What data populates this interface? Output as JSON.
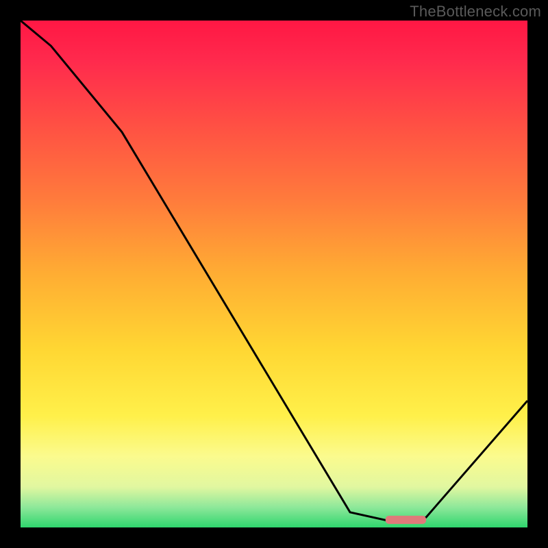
{
  "watermark": "TheBottleneck.com",
  "chart_data": {
    "type": "line",
    "title": "",
    "xlabel": "",
    "ylabel": "",
    "xlim": [
      0,
      100
    ],
    "ylim": [
      0,
      100
    ],
    "grid": false,
    "series": [
      {
        "name": "curve",
        "x": [
          0,
          6,
          20,
          65,
          74,
          80,
          100
        ],
        "values": [
          100,
          95,
          78,
          3,
          1,
          2,
          25
        ]
      }
    ],
    "flat_segment": {
      "x_start": 72,
      "x_end": 80,
      "y": 1.5
    },
    "flat_marker_color": "#e07a7a",
    "curve_color": "#000000",
    "background_gradient": {
      "stops": [
        {
          "offset": 0.0,
          "color": "#ff1744"
        },
        {
          "offset": 0.08,
          "color": "#ff2a4d"
        },
        {
          "offset": 0.2,
          "color": "#ff4e44"
        },
        {
          "offset": 0.35,
          "color": "#ff7a3c"
        },
        {
          "offset": 0.5,
          "color": "#ffad33"
        },
        {
          "offset": 0.65,
          "color": "#ffd733"
        },
        {
          "offset": 0.78,
          "color": "#fff04a"
        },
        {
          "offset": 0.86,
          "color": "#fbfb8e"
        },
        {
          "offset": 0.92,
          "color": "#e1f7a0"
        },
        {
          "offset": 0.96,
          "color": "#8ee89a"
        },
        {
          "offset": 1.0,
          "color": "#2fd66e"
        }
      ]
    }
  }
}
